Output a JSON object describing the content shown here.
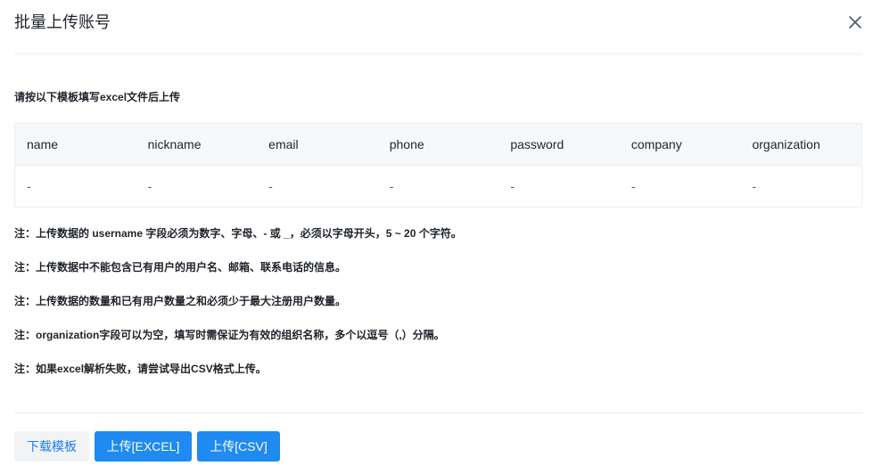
{
  "dialog": {
    "title": "批量上传账号",
    "close_icon": "close-icon"
  },
  "instruction": "请按以下模板填写excel文件后上传",
  "template_table": {
    "columns": [
      "name",
      "nickname",
      "email",
      "phone",
      "password",
      "company",
      "organization"
    ],
    "rows": [
      [
        "-",
        "-",
        "-",
        "-",
        "-",
        "-",
        "-"
      ]
    ]
  },
  "notes": [
    "注：上传数据的 username 字段必须为数字、字母、- 或 _，必须以字母开头，5 ~ 20 个字符。",
    "注：上传数据中不能包含已有用户的用户名、邮箱、联系电话的信息。",
    "注：上传数据的数量和已有用户数量之和必须少于最大注册用户数量。",
    "注：organization字段可以为空，填写时需保证为有效的组织名称，多个以逗号（,）分隔。",
    "注：如果excel解析失败，请尝试导出CSV格式上传。"
  ],
  "footer": {
    "download_template_label": "下载模板",
    "upload_excel_label": "上传[EXCEL]",
    "upload_csv_label": "上传[CSV]"
  },
  "colors": {
    "primary": "#1f8af1",
    "secondary_text": "#1e7cf0",
    "table_header_bg": "#f7f8fa",
    "border": "#eceef2"
  }
}
